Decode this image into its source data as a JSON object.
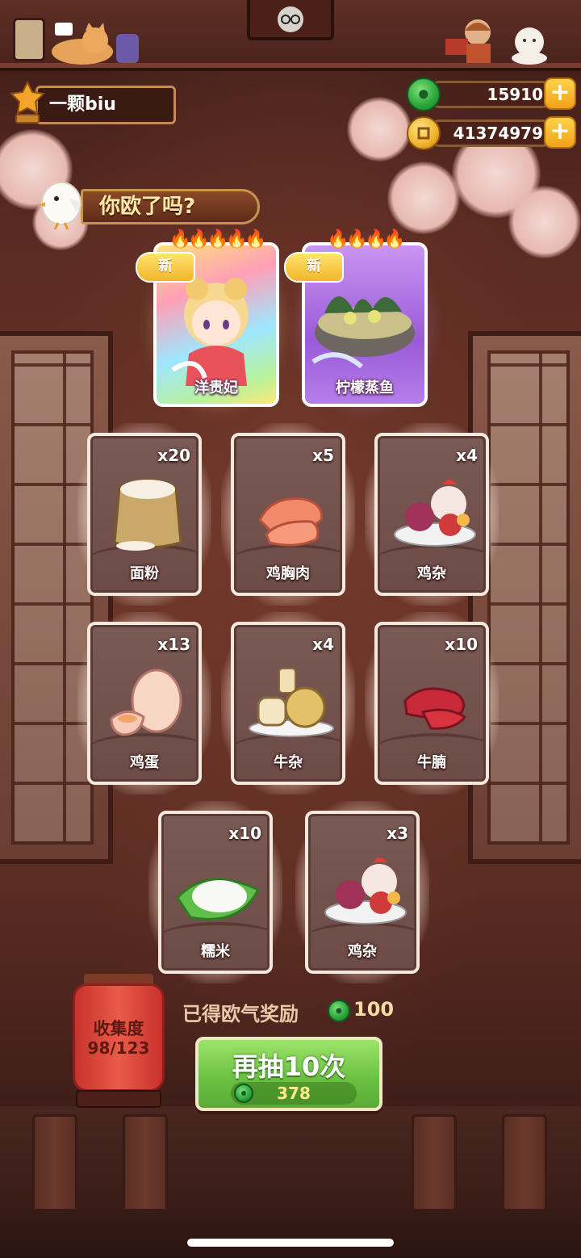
{
  "player": {
    "name": "一颗biu"
  },
  "currency": {
    "jade": "15910",
    "coins": "41374979",
    "add_symbol": "+"
  },
  "banner": {
    "text": "你欧了吗?"
  },
  "special_cards": [
    {
      "name": "洋贵妃",
      "tag": "新",
      "flames": "🔥🔥🔥🔥🔥",
      "rarity_color": "#f6e58a"
    },
    {
      "name": "柠檬蒸鱼",
      "tag": "新",
      "flames": "🔥🔥🔥🔥",
      "rarity_color": "#b37be6"
    }
  ],
  "items": [
    {
      "name": "面粉",
      "count": "x20",
      "icon": "flour-icon"
    },
    {
      "name": "鸡胸肉",
      "count": "x5",
      "icon": "chicken-breast-icon"
    },
    {
      "name": "鸡杂",
      "count": "x4",
      "icon": "chicken-giblets-icon"
    },
    {
      "name": "鸡蛋",
      "count": "x13",
      "icon": "egg-icon"
    },
    {
      "name": "牛杂",
      "count": "x4",
      "icon": "beef-offal-icon"
    },
    {
      "name": "牛腩",
      "count": "x10",
      "icon": "beef-brisket-icon"
    },
    {
      "name": "糯米",
      "count": "x10",
      "icon": "glutinous-rice-icon"
    },
    {
      "name": "鸡杂",
      "count": "x3",
      "icon": "chicken-giblets-icon"
    }
  ],
  "collection": {
    "label": "收集度",
    "progress": "98/123"
  },
  "reward": {
    "label": "已得欧气奖励",
    "value": "100"
  },
  "draw_button": {
    "label": "再抽10次",
    "cost": "378"
  }
}
